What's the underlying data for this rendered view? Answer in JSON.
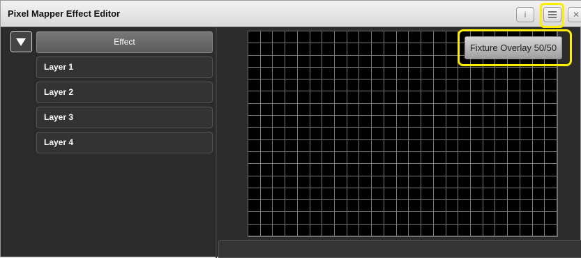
{
  "window": {
    "title": "Pixel Mapper Effect Editor"
  },
  "titlebar_buttons": {
    "info_label": "i",
    "close_label": "✕"
  },
  "left_panel": {
    "effect_label": "Effect",
    "layers": [
      "Layer 1",
      "Layer 2",
      "Layer 3",
      "Layer 4"
    ]
  },
  "overlay_menu": {
    "item_label": "Fixture Overlay 50/50"
  },
  "pixel_grid": {
    "columns": 25,
    "rows": 17
  },
  "highlight_color": "#ffee00",
  "icons": {
    "dropdown": "triangle-down-icon",
    "menu": "hamburger-menu-icon",
    "info": "info-icon",
    "close": "close-icon"
  }
}
